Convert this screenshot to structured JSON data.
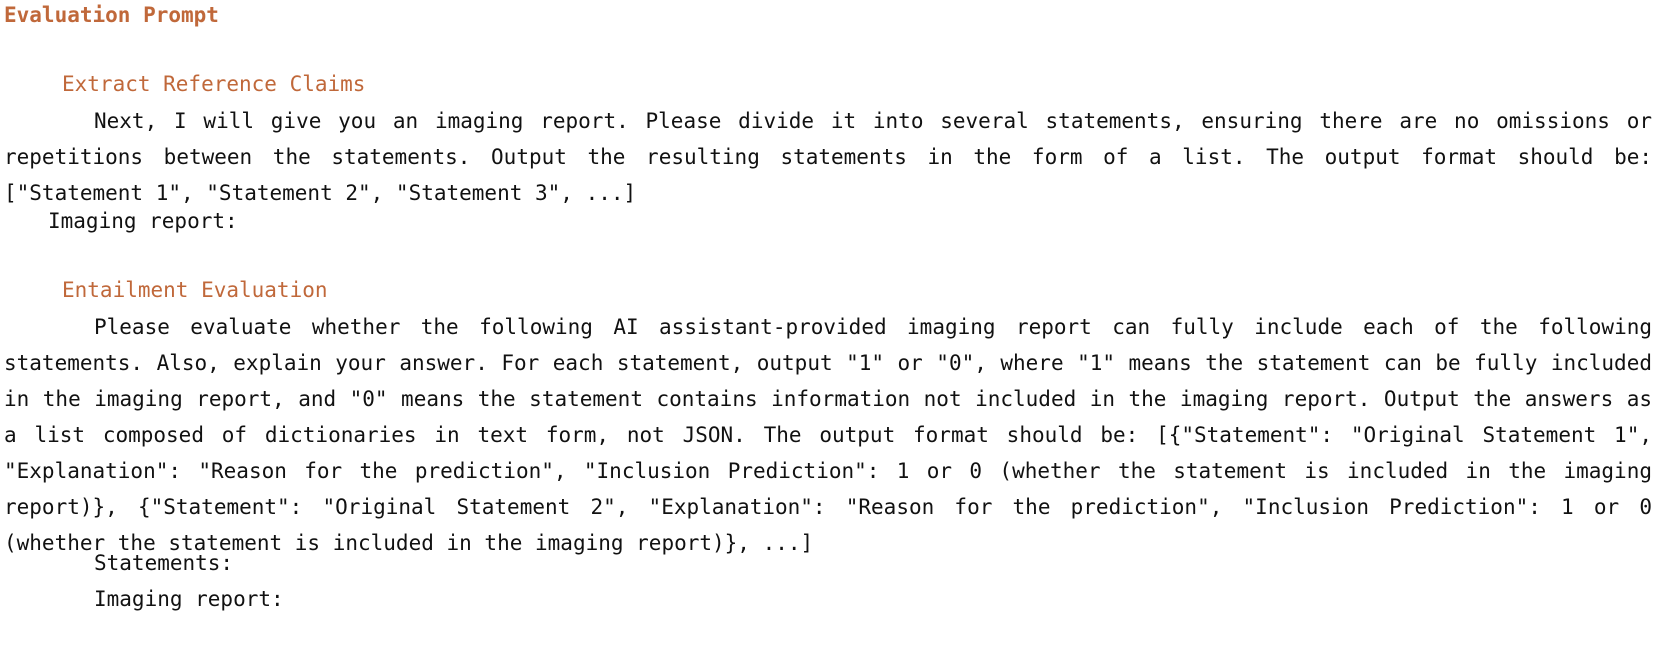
{
  "title": "Evaluation Prompt",
  "sections": [
    {
      "heading": "Extract Reference Claims",
      "paragraph": "Next, I will give you an imaging report. Please divide it into several statements, ensuring there are no omissions or repetitions between the statements. Output the resulting statements in the form of a list. The output format should be: [\"Statement 1\", \"Statement 2\", \"Statement 3\", ...]",
      "fields": [
        "Imaging report:"
      ]
    },
    {
      "heading": "Entailment Evaluation",
      "paragraph": "Please evaluate whether the following AI assistant-provided imaging report can fully include each of the following statements. Also, explain your answer. For each statement, output \"1\" or \"0\", where \"1\" means the statement can be fully included in the imaging report, and \"0\" means the statement contains information not included in the imaging report. Output the answers as a list composed of dictionaries in text form, not JSON. The output format should be: [{\"Statement\": \"Original Statement 1\", \"Explanation\": \"Reason for the prediction\", \"Inclusion Prediction\": 1 or 0 (whether the statement is included in the imaging report)}, {\"Statement\": \"Original Statement 2\", \"Explanation\": \"Reason for the prediction\", \"Inclusion Prediction\": 1 or 0 (whether the statement is included in the imaging report)}, ...]",
      "fields": [
        "Statements:",
        "Imaging report:"
      ]
    }
  ]
}
